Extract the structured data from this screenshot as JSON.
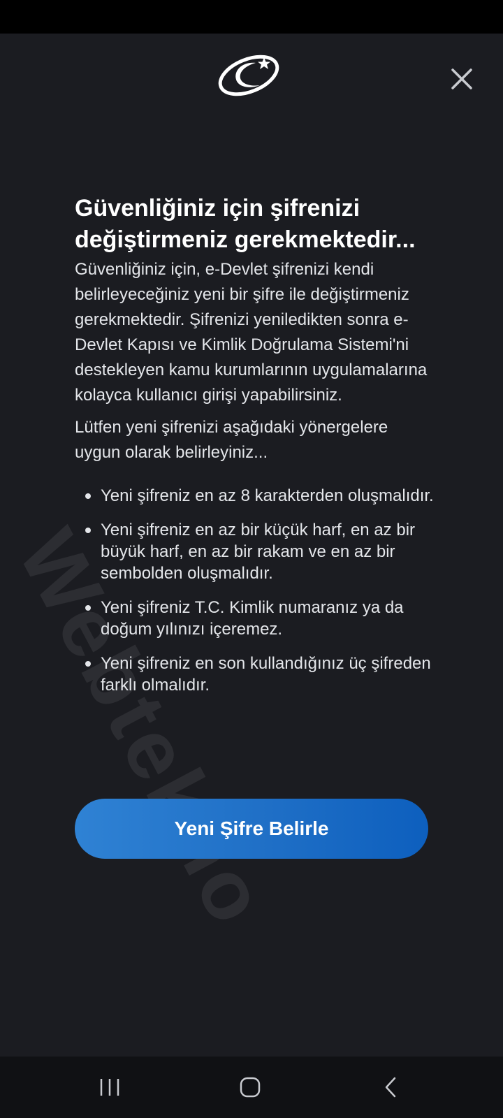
{
  "modal": {
    "close_icon": "close-icon",
    "logo_icon": "e-devlet-logo",
    "title": "Güvenliğiniz için şifrenizi değiştirmeniz gerekmektedir...",
    "paragraphs": [
      "Güvenliğiniz için, e-Devlet şifrenizi kendi belirleyeceğiniz yeni bir şifre ile değiştirmeniz gerekmektedir. Şifrenizi yeniledikten sonra e-Devlet Kapısı ve Kimlik Doğrulama Sistemi'ni destekleyen kamu kurumlarının uygulamalarına kolayca kullanıcı girişi yapabilirsiniz.",
      "Lütfen yeni şifrenizi aşağıdaki yönergelere uygun olarak belirleyiniz..."
    ],
    "rules": [
      "Yeni şifreniz en az 8 karakterden oluşmalıdır.",
      "Yeni şifreniz en az bir küçük harf, en az bir büyük harf, en az bir rakam ve en az bir sembolden oluşmalıdır.",
      "Yeni şifreniz T.C. Kimlik numaranız ya da doğum yılınızı içeremez.",
      "Yeni şifreniz en son kullandığınız üç şifreden farklı olmalıdır."
    ],
    "button_label": "Yeni Şifre Belirle"
  },
  "watermark": "Webtekno",
  "nav": {
    "recents_icon": "recents-icon",
    "home_icon": "home-icon",
    "back_icon": "back-icon"
  },
  "colors": {
    "background": "#1b1c21",
    "button_start": "#2f82d4",
    "button_end": "#0d5fbe",
    "text": "#e4e6ea"
  }
}
